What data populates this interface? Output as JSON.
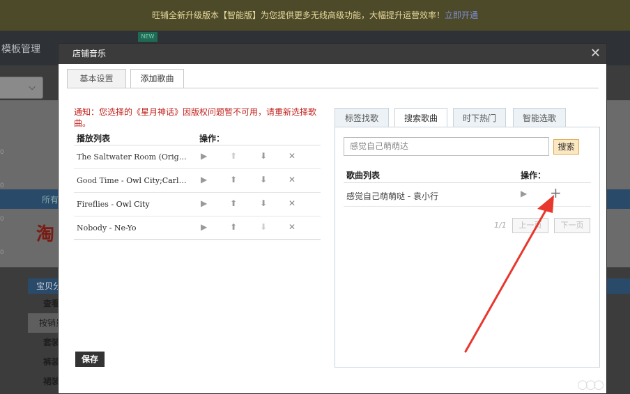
{
  "banner": {
    "text": "旺铺全新升级版本【智能版】为您提供更多无线高级功能，大幅提升运营效率！",
    "link": "立即开通"
  },
  "background": {
    "nav_label": "模板管理",
    "green_badge": "NEW",
    "logo_text": "淘",
    "strip_text": "所有",
    "side_head": "宝贝分",
    "side_items": [
      "查看",
      "按销量",
      "套装",
      "裤装",
      "裙装"
    ],
    "ticks": [
      "0",
      "0",
      "0",
      "0"
    ]
  },
  "modal": {
    "title": "店铺音乐",
    "tabs": [
      {
        "label": "基本设置"
      },
      {
        "label": "添加歌曲"
      }
    ],
    "notice": "通知：您选择的《星月神话》因版权问题暂不可用，请重新选择歌曲。",
    "playlist": {
      "col_list": "播放列表",
      "col_ops": "操作：",
      "rows": [
        {
          "title": "The Saltwater Room (Original ...",
          "artist": ""
        },
        {
          "title": "Good Time - ",
          "artist": "Owl City;Carly ..."
        },
        {
          "title": "Fireflies - ",
          "artist": "Owl City"
        },
        {
          "title": "Nobody - ",
          "artist": "Ne-Yo"
        }
      ]
    },
    "save_label": "保存",
    "right_tabs": [
      {
        "label": "标签找歌"
      },
      {
        "label": "搜索歌曲"
      },
      {
        "label": "时下热门"
      },
      {
        "label": "智能选歌"
      }
    ],
    "search": {
      "value": "感觉自己萌萌达",
      "button": "搜索"
    },
    "song_list": {
      "col_list": "歌曲列表",
      "col_ops": "操作：",
      "rows": [
        {
          "name": "感觉自己萌萌哒 - 袁小行"
        }
      ]
    },
    "pager": {
      "count": "1/1",
      "prev": "上一页",
      "next": "下一页"
    }
  },
  "icons": {
    "close": "close-icon",
    "play": "play-icon",
    "up": "arrow-up-icon",
    "down": "arrow-down-icon",
    "delete": "delete-icon",
    "add": "plus-icon",
    "select_chevron": "chevron-down-icon"
  },
  "colors": {
    "notice": "#c0211c",
    "annotation_arrow": "#e8372c",
    "search_button_border": "#e0a94e",
    "modal_header": "#3b3b3b"
  }
}
